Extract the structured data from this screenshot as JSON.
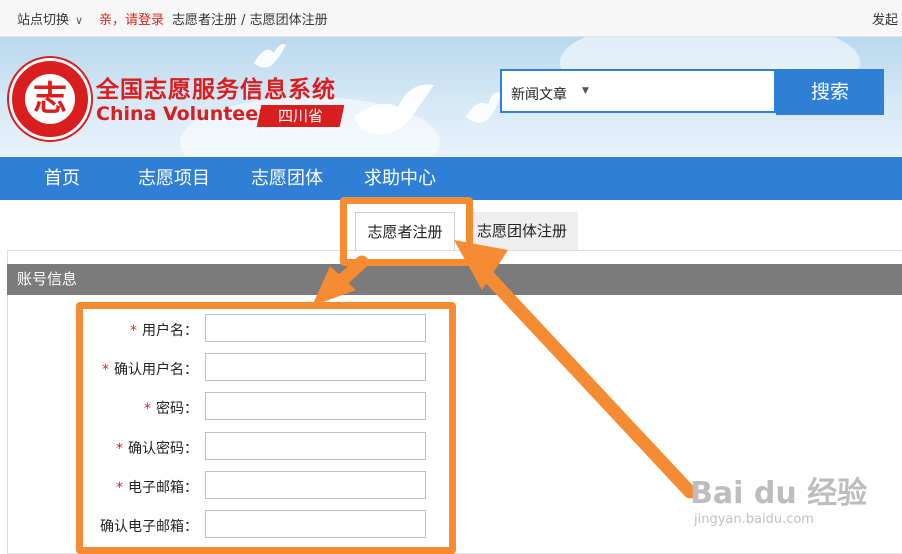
{
  "topbar": {
    "site_switch": "站点切换",
    "login": "亲，请登录",
    "register": "志愿者注册 / 志愿团体注册",
    "right_link": "发起"
  },
  "header": {
    "site_name_cn": "全国志愿服务信息系统",
    "site_name_en": "China Volunteer",
    "province": "四川省",
    "search": {
      "category": "新闻文章",
      "button": "搜索"
    }
  },
  "nav": {
    "items": [
      "首页",
      "志愿项目",
      "志愿团体",
      "求助中心"
    ]
  },
  "tabs": {
    "volunteer": "志愿者注册",
    "group": "志愿团体注册"
  },
  "section": {
    "title": "账号信息"
  },
  "form": {
    "fields": [
      {
        "label": "用户名：",
        "required": "*",
        "value": ""
      },
      {
        "label": "确认用户名：",
        "required": "*",
        "value": ""
      },
      {
        "label": "密码：",
        "required": "*",
        "value": ""
      },
      {
        "label": "确认密码：",
        "required": "*",
        "value": ""
      },
      {
        "label": "电子邮箱：",
        "required": "*",
        "value": ""
      },
      {
        "label": "确认电子邮箱：",
        "required": "",
        "value": ""
      }
    ]
  },
  "watermark": {
    "brand": "Bai du 经验",
    "url": "jingyan.baidu.com"
  },
  "colors": {
    "brand_red": "#d81e1e",
    "nav_blue": "#2f7fd6",
    "annotation_orange": "#f58b32"
  },
  "icons": [
    "chevron-down-icon",
    "caret-down-icon",
    "volunteer-logo-icon",
    "dove-icon",
    "arrow-annotation-icon"
  ]
}
